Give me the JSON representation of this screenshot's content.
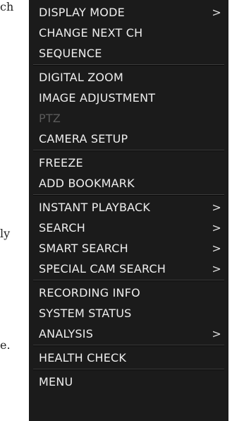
{
  "background_fragments": [
    "ch",
    "ly",
    "e."
  ],
  "menu": {
    "groups": [
      {
        "items": [
          {
            "label": "DISPLAY MODE",
            "arrow": ">"
          },
          {
            "label": "CHANGE NEXT CH",
            "arrow": ""
          },
          {
            "label": "SEQUENCE",
            "arrow": ""
          }
        ]
      },
      {
        "items": [
          {
            "label": "DIGITAL ZOOM",
            "arrow": ""
          },
          {
            "label": "IMAGE ADJUSTMENT",
            "arrow": ""
          },
          {
            "label": "PTZ",
            "arrow": "",
            "disabled": true
          },
          {
            "label": "CAMERA SETUP",
            "arrow": ""
          }
        ]
      },
      {
        "items": [
          {
            "label": "FREEZE",
            "arrow": ""
          },
          {
            "label": "ADD BOOKMARK",
            "arrow": ""
          }
        ]
      },
      {
        "items": [
          {
            "label": "INSTANT PLAYBACK",
            "arrow": ">"
          },
          {
            "label": "SEARCH",
            "arrow": ">"
          },
          {
            "label": "SMART SEARCH",
            "arrow": ">"
          },
          {
            "label": "SPECIAL CAM SEARCH",
            "arrow": ">"
          }
        ]
      },
      {
        "items": [
          {
            "label": "RECORDING INFO",
            "arrow": ""
          },
          {
            "label": "SYSTEM STATUS",
            "arrow": ""
          },
          {
            "label": "ANALYSIS",
            "arrow": ">"
          }
        ]
      },
      {
        "items": [
          {
            "label": "HEALTH CHECK",
            "arrow": ""
          }
        ]
      },
      {
        "items": [
          {
            "label": "MENU",
            "arrow": ""
          }
        ]
      }
    ]
  },
  "colors": {
    "menu_background": "#1b1b1b",
    "text": "#eeeeee",
    "disabled_text": "#5a5a5a"
  }
}
